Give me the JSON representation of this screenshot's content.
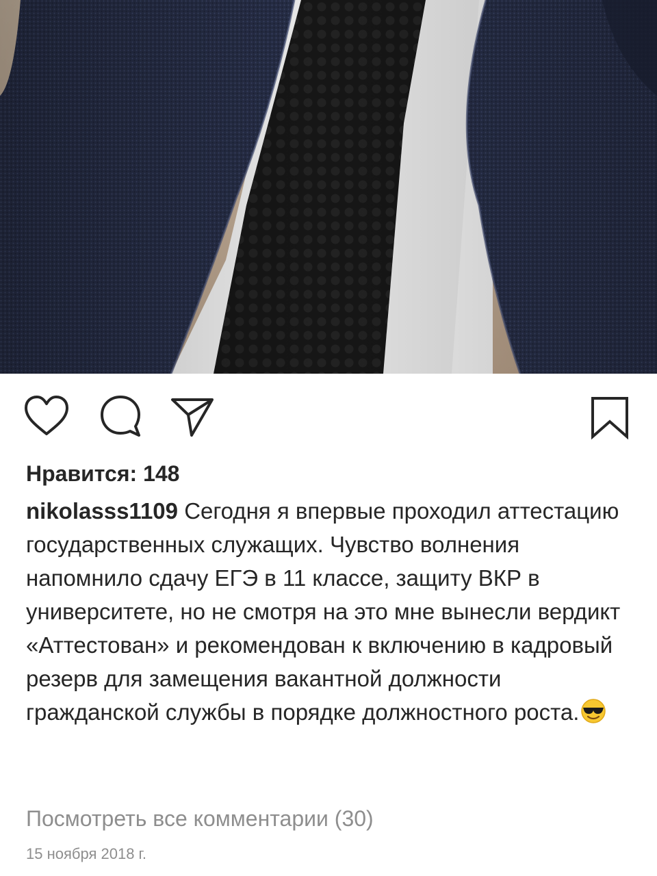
{
  "post": {
    "photo_icon": "suit-and-tie-photo",
    "likes": {
      "label": "Нравится:",
      "count": "148"
    },
    "caption": {
      "username": "nikolasss1109",
      "text": "Сегодня я впервые проходил аттестацию государственных служащих. Чувство волнения напомнило сдачу ЕГЭ в 11 классе, защиту ВКР в университете, но не смотря на это мне вынесли вердикт «Аттестован» и рекомендован к включению в кадровый резерв для замещения вакантной должности гражданской службы в порядке должностного роста.",
      "emoji": "smiling-face-with-sunglasses"
    },
    "view_comments": "Посмотреть все комментарии (30)",
    "date": "15 ноября 2018 г."
  },
  "actions": {
    "like_icon": "heart-icon",
    "comment_icon": "comment-bubble-icon",
    "share_icon": "paper-plane-icon",
    "save_icon": "bookmark-icon"
  },
  "colors": {
    "text": "#262626",
    "secondary_text": "#8e8e8e",
    "jacket": "#262d45",
    "shirt": "#ececec",
    "tie": "#151515"
  }
}
